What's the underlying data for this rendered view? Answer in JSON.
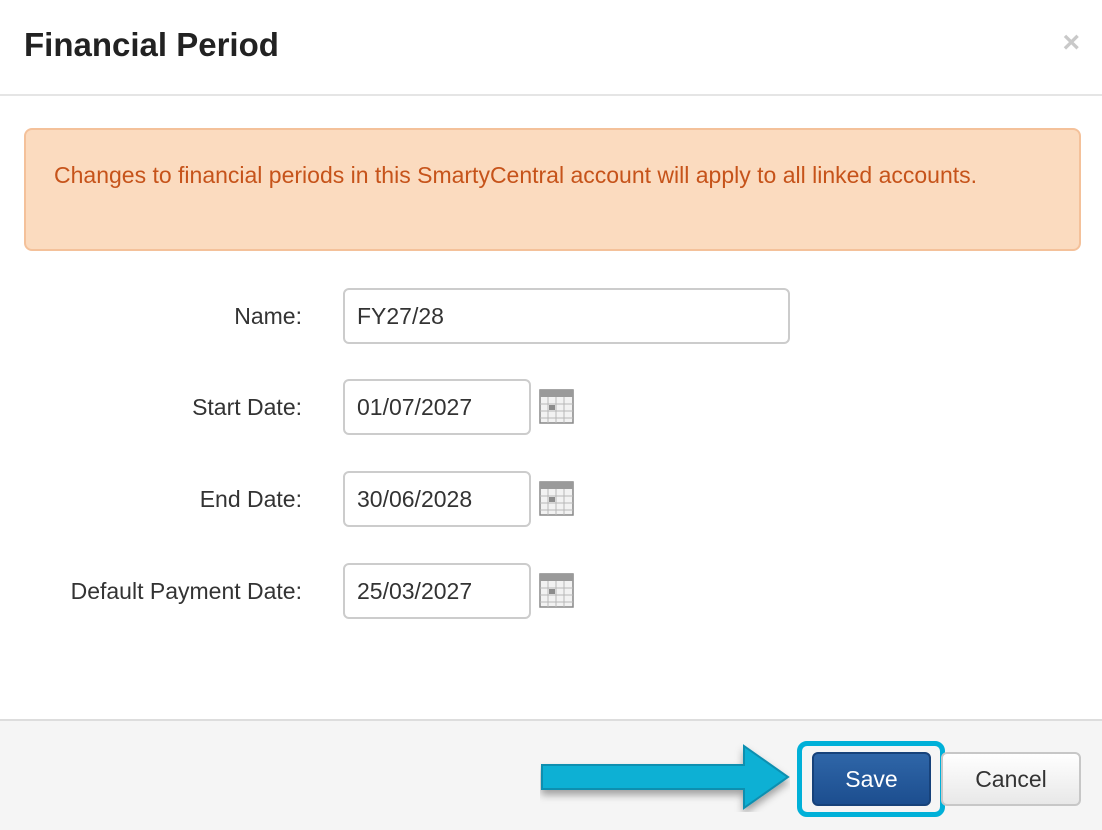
{
  "dialog": {
    "title": "Financial Period",
    "close_symbol": "×"
  },
  "alert": {
    "message": "Changes to financial periods in this SmartyCentral account will apply to all linked accounts."
  },
  "form": {
    "name": {
      "label": "Name:",
      "value": "FY27/28"
    },
    "start_date": {
      "label": "Start Date:",
      "value": "01/07/2027"
    },
    "end_date": {
      "label": "End Date:",
      "value": "30/06/2028"
    },
    "default_payment_date": {
      "label": "Default Payment Date:",
      "value": "25/03/2027"
    }
  },
  "footer": {
    "save_label": "Save",
    "cancel_label": "Cancel"
  },
  "colors": {
    "alert_background": "#fbdbbf",
    "alert_text": "#c6531a",
    "primary_button": "#1c4e8f",
    "highlight": "#00b0d8"
  },
  "icons": [
    "close-icon",
    "calendar-icon",
    "pointer-arrow-icon"
  ]
}
